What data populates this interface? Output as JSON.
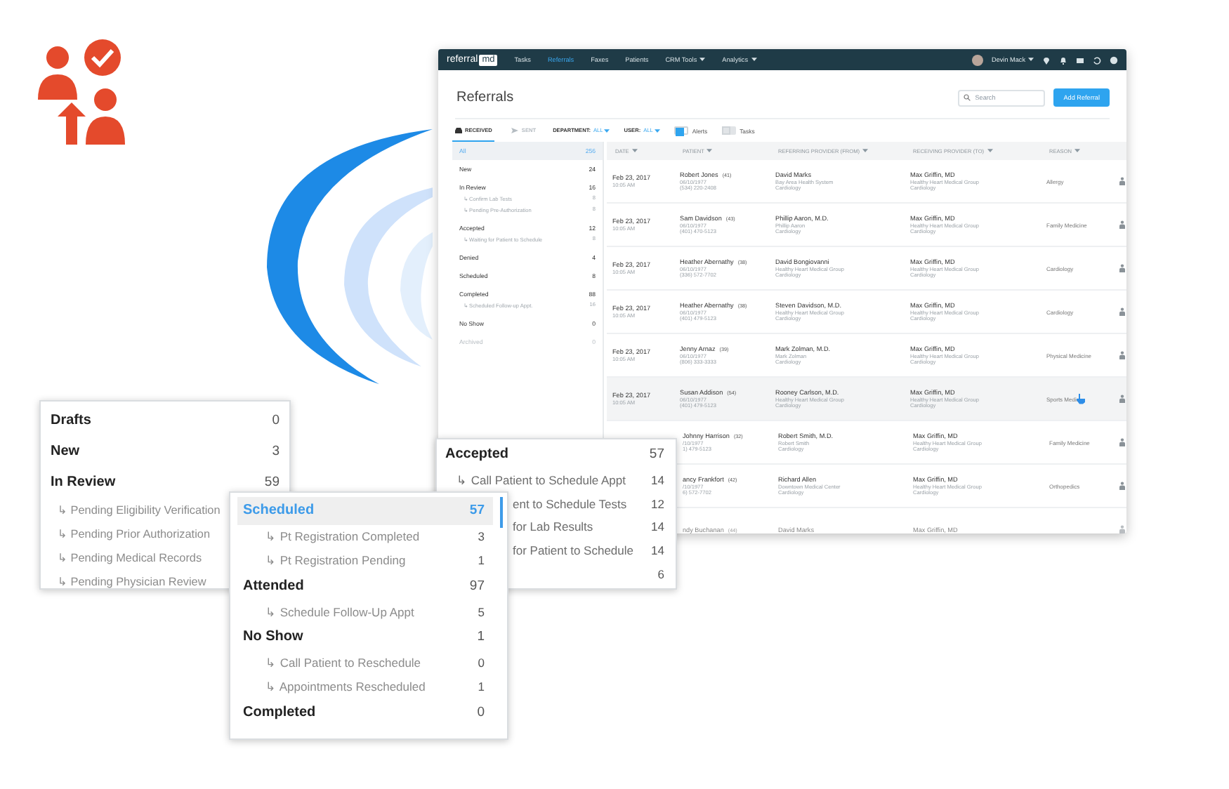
{
  "app": {
    "nav": {
      "logo": {
        "text": "referral",
        "badge": "md"
      },
      "items": [
        {
          "label": "Tasks",
          "selected": false,
          "dropdown": false
        },
        {
          "label": "Referrals",
          "selected": true,
          "dropdown": false
        },
        {
          "label": "Faxes",
          "selected": false,
          "dropdown": false
        },
        {
          "label": "Patients",
          "selected": false,
          "dropdown": false
        },
        {
          "label": "CRM Tools",
          "selected": false,
          "dropdown": true
        },
        {
          "label": "Analytics",
          "selected": false,
          "dropdown": true
        }
      ],
      "user": {
        "name": "Devin Mack"
      }
    },
    "page_title": "Referrals",
    "search": {
      "placeholder": "Search"
    },
    "add_button": "Add Referral",
    "direction_tabs": [
      {
        "label": "RECEIVED",
        "selected": true
      },
      {
        "label": "SENT",
        "selected": false
      }
    ],
    "filters": [
      {
        "label": "DEPARTMENT:",
        "value": "ALL"
      },
      {
        "label": "USER:",
        "value": "ALL"
      }
    ],
    "toggles": [
      {
        "label": "Alerts",
        "on": true
      },
      {
        "label": "Tasks",
        "on": false
      }
    ],
    "sidebar": {
      "items": [
        {
          "label": "All",
          "count": "256",
          "selected": true,
          "disabled": false
        },
        {
          "label": "New",
          "count": "24",
          "selected": false,
          "disabled": false
        },
        {
          "label": "In Review",
          "count": "16",
          "selected": false,
          "disabled": false,
          "children": [
            {
              "label": "↳ Confirm Lab Tests",
              "count": "8"
            },
            {
              "label": "↳ Pending Pre-Authorization",
              "count": "8"
            }
          ]
        },
        {
          "label": "Accepted",
          "count": "12",
          "selected": false,
          "disabled": false,
          "children": [
            {
              "label": "↳ Waiting for Patient to Schedule",
              "count": "8"
            }
          ]
        },
        {
          "label": "Denied",
          "count": "4",
          "selected": false,
          "disabled": false
        },
        {
          "label": "Scheduled",
          "count": "8",
          "selected": false,
          "disabled": false
        },
        {
          "label": "Completed",
          "count": "88",
          "selected": false,
          "disabled": false,
          "children": [
            {
              "label": "↳ Scheduled Follow-up Appt.",
              "count": "16"
            }
          ]
        },
        {
          "label": "No Show",
          "count": "0",
          "selected": false,
          "disabled": false
        },
        {
          "label": "Archived",
          "count": "0",
          "selected": false,
          "disabled": true
        }
      ]
    },
    "table": {
      "columns": [
        "DATE",
        "PATIENT",
        "REFERRING PROVIDER (FROM)",
        "RECEIVING PROVIDER (TO)",
        "REASON"
      ],
      "rows": [
        {
          "date": "Feb 23, 2017",
          "time": "10:05 AM",
          "patient": {
            "name": "Robert Jones",
            "age": "(41)",
            "dob": "06/10/1977",
            "phone": "(534) 220-2408"
          },
          "from": {
            "name": "David Marks",
            "org": "Bay Area Health System",
            "specialty": "Cardiology"
          },
          "to": {
            "name": "Max Griffin, MD",
            "org": "Healthy Heart Medical Group",
            "specialty": "Cardiology"
          },
          "reason": "Allergy",
          "highlighted": false,
          "faded": false,
          "cursor": false
        },
        {
          "date": "Feb 23, 2017",
          "time": "10:05 AM",
          "patient": {
            "name": "Sam Davidson",
            "age": "(43)",
            "dob": "06/10/1977",
            "phone": "(401) 470-5123"
          },
          "from": {
            "name": "Phillip Aaron, M.D.",
            "org": "Phillip Aaron",
            "specialty": "Cardiology"
          },
          "to": {
            "name": "Max Griffin, MD",
            "org": "Healthy Heart Medical Group",
            "specialty": "Cardiology"
          },
          "reason": "Family Medicine",
          "highlighted": false,
          "faded": false,
          "cursor": false
        },
        {
          "date": "Feb 23, 2017",
          "time": "10:05 AM",
          "patient": {
            "name": "Heather Abernathy",
            "age": "(38)",
            "dob": "06/10/1977",
            "phone": "(336) 572-7702"
          },
          "from": {
            "name": "David Bongiovanni",
            "org": "Healthy Heart Medical Group",
            "specialty": "Cardiology"
          },
          "to": {
            "name": "Max Griffin, MD",
            "org": "Healthy Heart Medical Group",
            "specialty": "Cardiology"
          },
          "reason": "Cardiology",
          "highlighted": false,
          "faded": false,
          "cursor": false
        },
        {
          "date": "Feb 23, 2017",
          "time": "10:05 AM",
          "patient": {
            "name": "Heather Abernathy",
            "age": "(38)",
            "dob": "06/10/1977",
            "phone": "(401) 479-5123"
          },
          "from": {
            "name": "Steven Davidson, M.D.",
            "org": "Healthy Heart Medical Group",
            "specialty": "Cardiology"
          },
          "to": {
            "name": "Max Griffin, MD",
            "org": "Healthy Heart Medical Group",
            "specialty": "Cardiology"
          },
          "reason": "Cardiology",
          "highlighted": false,
          "faded": false,
          "cursor": false
        },
        {
          "date": "Feb 23, 2017",
          "time": "10:05 AM",
          "patient": {
            "name": "Jenny Arnaz",
            "age": "(39)",
            "dob": "06/10/1977",
            "phone": "(806) 333-3333"
          },
          "from": {
            "name": "Mark Zolman, M.D.",
            "org": "Mark Zolman",
            "specialty": "Cardiology"
          },
          "to": {
            "name": "Max Griffin, MD",
            "org": "Healthy Heart Medical Group",
            "specialty": "Cardiology"
          },
          "reason": "Physical Medicine",
          "highlighted": false,
          "faded": false,
          "cursor": false
        },
        {
          "date": "Feb 23, 2017",
          "time": "10:05 AM",
          "patient": {
            "name": "Susan Addison",
            "age": "(54)",
            "dob": "06/10/1977",
            "phone": "(401) 479-5123"
          },
          "from": {
            "name": "Rooney Carlson, M.D.",
            "org": "Healthy Heart Medical Group",
            "specialty": "Cardiology"
          },
          "to": {
            "name": "Max Griffin, MD",
            "org": "Healthy Heart Medical Group",
            "specialty": "Cardiology"
          },
          "reason": "Sports Medic",
          "highlighted": true,
          "faded": false,
          "cursor": true
        },
        {
          "patient": {
            "name": "Johnny Harrison",
            "age": "(32)",
            "dob": "/10/1977",
            "phone": "1) 479-5123"
          },
          "from": {
            "name": "Robert Smith, M.D.",
            "org": "Robert Smith",
            "specialty": "Cardiology"
          },
          "to": {
            "name": "Max Griffin, MD",
            "org": "Healthy Heart Medical Group",
            "specialty": "Cardiology"
          },
          "reason": "Family Medicine",
          "highlighted": false,
          "faded": false,
          "cursor": false
        },
        {
          "patient": {
            "name": "ancy Frankfort",
            "age": "(42)",
            "dob": "/10/1977",
            "phone": "6) 572-7702"
          },
          "from": {
            "name": "Richard Allen",
            "org": "Downtown Medical Center",
            "specialty": "Cardiology"
          },
          "to": {
            "name": "Max Griffin, MD",
            "org": "Healthy Heart Medical Group",
            "specialty": "Cardiology"
          },
          "reason": "Orthopedics",
          "highlighted": false,
          "faded": false,
          "cursor": false
        },
        {
          "patient": {
            "name": "ndy Buchanan",
            "age": "(44)"
          },
          "from": {
            "name": "David Marks"
          },
          "to": {
            "name": "Max Griffin, MD"
          },
          "highlighted": false,
          "faded": true,
          "cursor": false
        }
      ]
    }
  },
  "cards": [
    {
      "items": [
        {
          "kind": "header",
          "label": "Drafts",
          "count": "0",
          "selected": false
        },
        {
          "kind": "header",
          "label": "New",
          "count": "3",
          "selected": false
        },
        {
          "kind": "header",
          "label": "In Review",
          "count": "59",
          "selected": false
        },
        {
          "kind": "sub",
          "label": "↳ Pending Eligibility Verification",
          "selected": false
        },
        {
          "kind": "sub",
          "label": "↳ Pending Prior Authorization",
          "selected": false
        },
        {
          "kind": "sub",
          "label": "↳ Pending Medical Records",
          "selected": false
        },
        {
          "kind": "sub",
          "label": "↳ Pending Physician Review",
          "selected": false
        }
      ]
    },
    {
      "items": [
        {
          "kind": "header",
          "label": "Accepted",
          "count": "57",
          "selected": false
        },
        {
          "kind": "sub",
          "label": "↳ Call Patient to Schedule Appt",
          "count": "14",
          "selected": false
        },
        {
          "kind": "covered",
          "label": "ent to Schedule Tests",
          "count": "12",
          "selected": false
        },
        {
          "kind": "covered",
          "label": "for Lab Results",
          "count": "14",
          "selected": false
        },
        {
          "kind": "covered",
          "label": "for Patient to Schedule",
          "count": "14",
          "selected": false
        },
        {
          "kind": "covered",
          "count": "6",
          "selected": false
        }
      ]
    },
    {
      "items": [
        {
          "kind": "header",
          "label": "Scheduled",
          "count": "57",
          "selected": true
        },
        {
          "kind": "sub",
          "label": "↳ Pt Registration Completed",
          "count": "3",
          "selected": false
        },
        {
          "kind": "sub",
          "label": "↳ Pt Registration Pending",
          "count": "1",
          "selected": false
        },
        {
          "kind": "header",
          "label": "Attended",
          "count": "97",
          "selected": false
        },
        {
          "kind": "sub",
          "label": "↳ Schedule Follow-Up Appt",
          "count": "5",
          "selected": false
        },
        {
          "kind": "header",
          "label": "No Show",
          "count": "1",
          "selected": false
        },
        {
          "kind": "sub",
          "label": "↳ Call Patient to Reschedule",
          "count": "0",
          "selected": false
        },
        {
          "kind": "sub",
          "label": "↳ Appointments Rescheduled",
          "count": "1",
          "selected": false
        },
        {
          "kind": "header",
          "label": "Completed",
          "count": "0",
          "selected": false
        }
      ]
    }
  ]
}
